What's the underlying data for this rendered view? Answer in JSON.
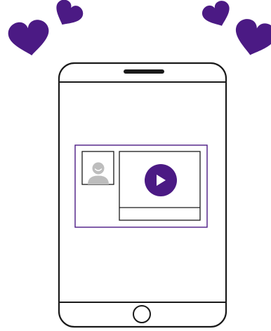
{
  "illustration": {
    "subject": "smartphone-video-message",
    "colors": {
      "accent": "#4b1a84",
      "outline": "#1a1a1a",
      "avatar_gray": "#bdbdbd",
      "background": "#ffffff",
      "play_glyph": "#ffffff"
    },
    "icons": [
      "heart-icon",
      "heart-icon",
      "heart-icon",
      "heart-icon",
      "avatar-icon",
      "play-icon",
      "home-button"
    ]
  }
}
